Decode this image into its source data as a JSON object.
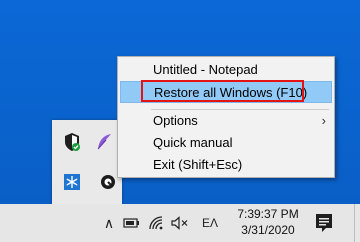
{
  "context_menu": {
    "items": [
      {
        "label": "Untitled - Notepad"
      },
      {
        "label": "Restore all Windows (F10)"
      },
      {
        "label": "Options"
      },
      {
        "label": "Quick manual"
      },
      {
        "label": "Exit (Shift+Esc)"
      }
    ],
    "highlighted_item": "Restore all Windows (F10)",
    "submenu_arrow": "›"
  },
  "tray_flyout": {
    "icons": [
      "defender-shield-icon",
      "feather-icon",
      "snowflake-icon",
      "app-circle-icon"
    ]
  },
  "taskbar": {
    "chevron": "∧",
    "input_indicator": "EΛ",
    "clock": {
      "time": "7:39:37 PM",
      "date": "3/31/2020"
    }
  },
  "colors": {
    "desktop": "#0a63cf",
    "menu_highlight": "#91c9f7",
    "annotation_frame": "#e51414",
    "taskbar": "#e6e6e6"
  }
}
